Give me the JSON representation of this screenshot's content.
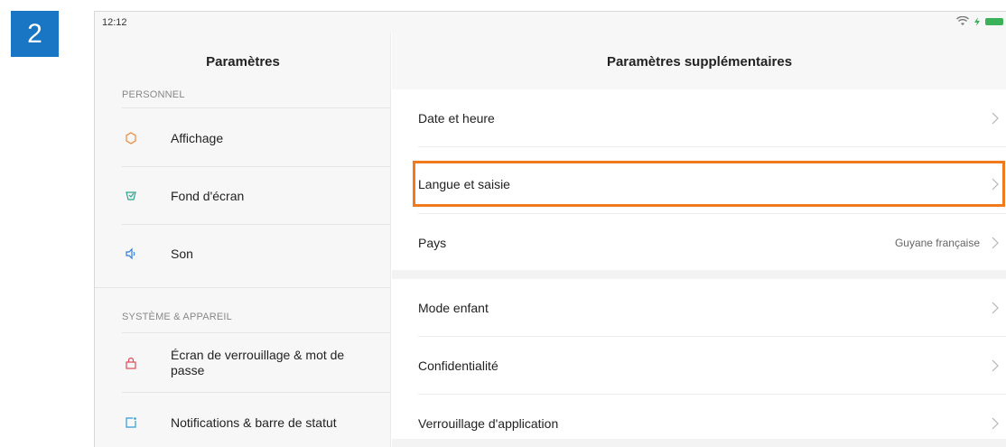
{
  "step": "2",
  "status": {
    "time": "12:12"
  },
  "left": {
    "title": "Paramètres",
    "section_personnel": "PERSONNEL",
    "items_personnel": [
      {
        "label": "Affichage",
        "icon": "display-icon"
      },
      {
        "label": "Fond d'écran",
        "icon": "wallpaper-icon"
      },
      {
        "label": "Son",
        "icon": "sound-icon"
      }
    ],
    "section_systeme": "SYSTÈME & APPAREIL",
    "items_systeme": [
      {
        "label": "Écran de verrouillage & mot de passe",
        "icon": "lock-icon"
      },
      {
        "label": "Notifications & barre de statut",
        "icon": "notifications-icon"
      }
    ]
  },
  "right": {
    "title": "Paramètres supplémentaires",
    "rows": [
      {
        "label": "Date et heure"
      },
      {
        "label": "Langue et saisie"
      },
      {
        "label": "Pays",
        "value": "Guyane française"
      },
      {
        "label": "Mode enfant"
      },
      {
        "label": "Confidentialité"
      },
      {
        "label": "Verrouillage d'application"
      }
    ]
  },
  "colors": {
    "highlight": "#f07a1c",
    "badge": "#1976c5",
    "battery": "#3bb15a"
  }
}
